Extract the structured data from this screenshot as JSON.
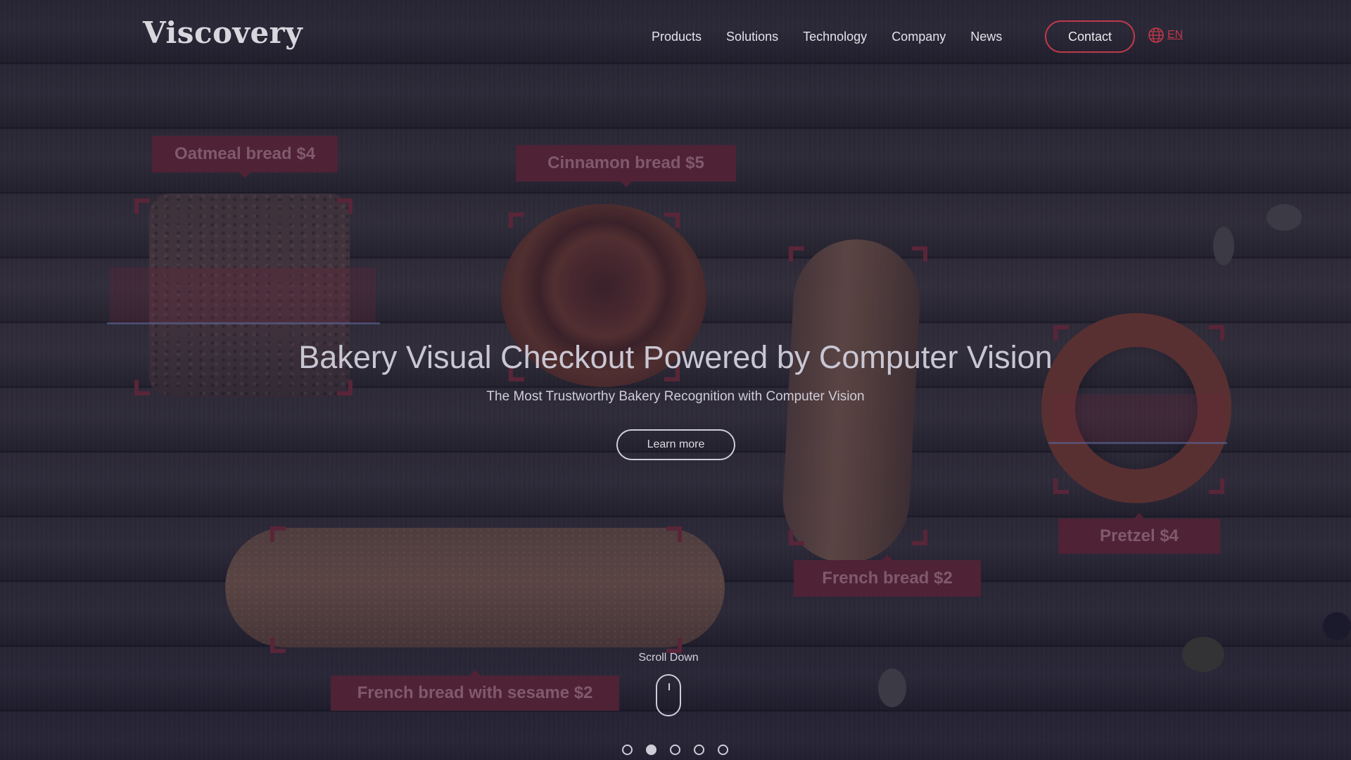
{
  "brand": {
    "logo": "Viscovery"
  },
  "nav": {
    "items": [
      "Products",
      "Solutions",
      "Technology",
      "Company",
      "News"
    ],
    "contact_label": "Contact",
    "language": "EN",
    "accent_color": "#c0394a"
  },
  "hero": {
    "title": "Bakery Visual Checkout Powered by Computer Vision",
    "subtitle": "The Most Trustworthy Bakery Recognition with Computer Vision",
    "cta_label": "Learn more"
  },
  "detections": {
    "oatmeal": "Oatmeal bread $4",
    "cinnamon": "Cinnamon bread  $5",
    "french": "French bread  $2",
    "pretzel": "Pretzel  $4",
    "sesame": "French bread with sesame $2"
  },
  "scroll": {
    "label": "Scroll Down"
  },
  "carousel": {
    "total": 5,
    "active_index": 2
  }
}
